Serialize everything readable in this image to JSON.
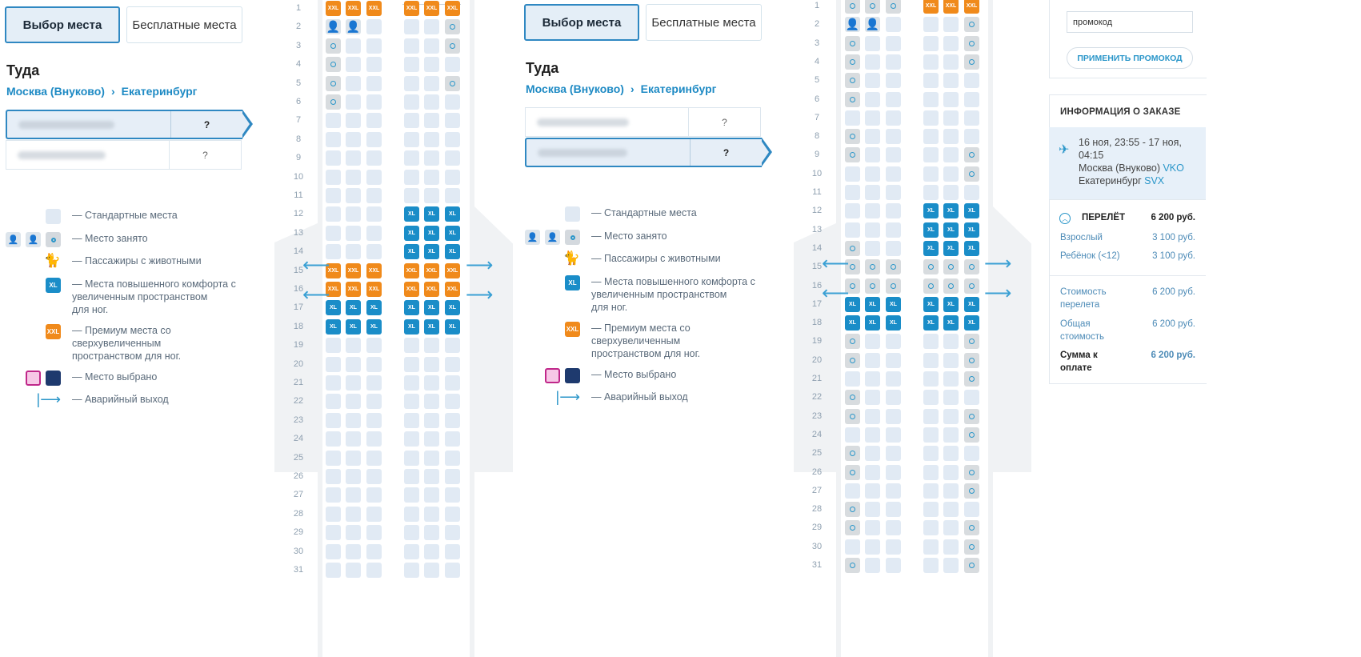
{
  "tabs": {
    "seat_select": "Выбор места",
    "free_seats": "Бесплатные места"
  },
  "direction": "Туда",
  "route": {
    "from": "Москва (Внуково)",
    "sep": "›",
    "to": "Екатеринбург"
  },
  "passengers": [
    {
      "seat": "?"
    },
    {
      "seat": "?"
    }
  ],
  "legend": {
    "standard": "— Стандартные места",
    "occupied": "— Место занято",
    "pets": "— Пассажиры с животными",
    "xl": "— Места повышенного комфорта с\nувеличенным пространством\nдля ног.",
    "xxl": "— Премиум места со\nсверхувеличенным\nпространством для ног.",
    "selected": "— Место выбрано",
    "exit": "— Аварийный выход",
    "xl_badge": "XL",
    "xxl_badge": "XXL"
  },
  "seatmap_left": [
    "ZZZ|ZZZ",
    "PPS|SSO",
    "OSS|SSO",
    "OSS|SSS",
    "OSS|SSO",
    "OSS|SSS",
    "SSS|SSS",
    "SSS|SSS",
    "SSS|SSS",
    "SSS|SSS",
    "SSS|SSS",
    "SSS|XXX",
    "SSS|XXX",
    "SSS|XXX",
    "ZZZ|ZZZ",
    "ZZZ|ZZZ",
    "XXX|XXX",
    "XXX|XXX",
    "SSS|SSS",
    "SSS|SSS",
    "SSS|SSS",
    "SSS|SSS",
    "SSS|SSS",
    "SSS|SSS",
    "SSS|SSS",
    "SSS|SSS",
    "SSS|SSS",
    "SSS|SSS",
    "SSS|SSS",
    "SSS|SSS",
    "SSS|SSS"
  ],
  "seatmap_right": [
    "OOO|ZZZ",
    "PPS|SSO",
    "OSS|SSO",
    "OSS|SSO",
    "OSS|SSS",
    "OSS|SSS",
    "SSS|SSS",
    "OSS|SSS",
    "OSS|SSO",
    "SSS|SSO",
    "SSS|SSS",
    "SSS|XXX",
    "SSS|XXX",
    "OSS|XXX",
    "OOO|OOO",
    "OOO|OOO",
    "XXX|XXX",
    "XXX|XXX",
    "OSS|SSO",
    "OSS|SSO",
    "SSS|SSO",
    "OSS|SSS",
    "OSS|SSO",
    "SSS|SSO",
    "OSS|SSS",
    "OSS|SSO",
    "SSS|SSO",
    "OSS|SSS",
    "OSS|SSO",
    "SSS|SSO",
    "OSS|SSO"
  ],
  "row_numbers": [
    "1",
    "2",
    "3",
    "4",
    "5",
    "6",
    "7",
    "8",
    "9",
    "10",
    "11",
    "12",
    "13",
    "14",
    "15",
    "16",
    "17",
    "18",
    "19",
    "20",
    "21",
    "22",
    "23",
    "24",
    "25",
    "26",
    "27",
    "28",
    "29",
    "30",
    "31"
  ],
  "promo": {
    "value": "промокод",
    "apply": "ПРИМЕНИТЬ ПРОМОКОД"
  },
  "order": {
    "title": "ИНФОРМАЦИЯ О ЗАКАЗЕ",
    "datetime": "16 ноя, 23:55 - 17 ноя, 04:15",
    "from_city": "Москва (Внуково)",
    "from_code": "VKO",
    "to_city": "Екатеринбург",
    "to_code": "SVX",
    "flight_label": "ПЕРЕЛЁТ",
    "flight_total": "6 200 руб.",
    "adult_label": "Взрослый",
    "adult_price": "3 100 руб.",
    "child_label": "Ребёнок (<12)",
    "child_price": "3 100 руб.",
    "cost_label": "Стоимость перелета",
    "cost_value": "6 200 руб.",
    "total_label": "Общая стоимость",
    "total_value": "6 200 руб.",
    "pay_label": "Сумма к оплате",
    "pay_value": "6 200 руб."
  },
  "colors": {
    "accent": "#2a96c9",
    "xl": "#1a8dc8",
    "xxl": "#f08a1b",
    "selected_pink": "#f7c8e6",
    "selected_dark": "#1e3a6e"
  }
}
